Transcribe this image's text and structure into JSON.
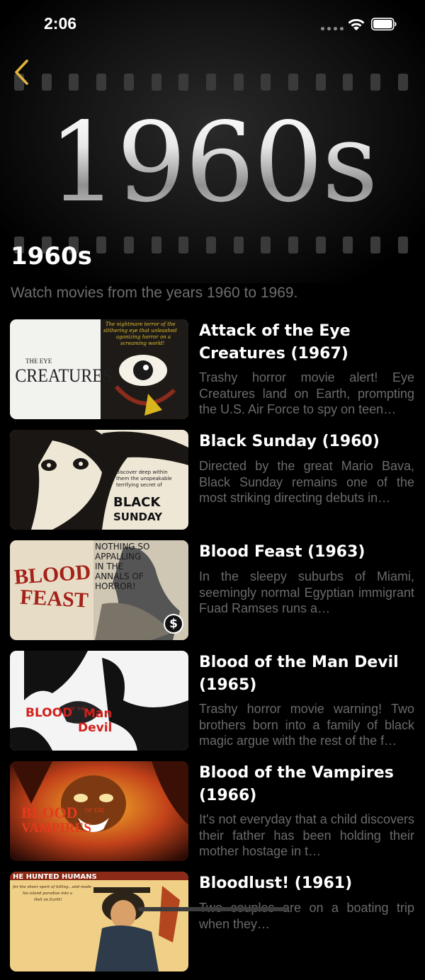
{
  "status_bar": {
    "time": "2:06"
  },
  "header": {
    "decade_graphic": "1960s",
    "title": "1960s",
    "subtitle": "Watch movies from the years 1960 to 1969."
  },
  "movies": [
    {
      "title": "Attack of the Eye Creatures (1967)",
      "description": "Trashy horror movie alert! Eye Creatures land on Earth, prompting the U.S. Air Force to spy on teen…",
      "poster": {
        "texts": [
          "THE EYE",
          "CREATURES",
          "The nightmare terror of the",
          "slithering eye that unleashed",
          "agonizing horror on a",
          "screaming world!"
        ]
      },
      "paid": false
    },
    {
      "title": "Black Sunday (1960)",
      "description": "Directed by the great Mario Bava, Black Sunday remains one of the most striking directing debuts in…",
      "poster": {
        "texts": [
          "discover deep within",
          "them the unspeakable",
          "terrifying secret of",
          "BLACK",
          "SUNDAY"
        ]
      },
      "paid": false
    },
    {
      "title": "Blood Feast (1963)",
      "description": "In the sleepy suburbs of Miami, seemingly normal Egyptian immigrant Fuad Ramses runs a…",
      "poster": {
        "texts": [
          "BLOOD",
          "FEAST",
          "NOTHING SO",
          "APPALLING",
          "IN THE",
          "ANNALS OF",
          "HORROR!"
        ]
      },
      "paid": true,
      "price_symbol": "$"
    },
    {
      "title": "Blood of the Man Devil (1965)",
      "description": "Trashy horror movie warning! Two brothers born into a family of black magic argue with the rest of the f…",
      "poster": {
        "texts": [
          "BLOOD",
          "OF THE",
          "Man",
          "Devil"
        ]
      },
      "paid": false
    },
    {
      "title": "Blood of the Vampires (1966)",
      "description": "It's not everyday that a child discovers their father has been holding their mother hostage in t…",
      "poster": {
        "texts": [
          "BLOOD",
          "OF THE",
          "VAMPIRES"
        ]
      },
      "paid": false
    },
    {
      "title": "Bloodlust! (1961)",
      "description": "Two couples are on a boating trip when they…",
      "poster": {
        "texts": [
          "HE HUNTED HUMANS",
          "for the sheer sport of killing...and made",
          "his island paradise into a",
          "Hell on Earth!"
        ]
      },
      "paid": false
    }
  ],
  "colors": {
    "background": "#000000",
    "accent": "#e2b33c",
    "secondary_text": "#6a6a6a"
  },
  "icons": {
    "back": "chevron-left-icon",
    "wifi": "wifi-icon",
    "battery": "battery-icon",
    "price": "dollar-icon"
  }
}
